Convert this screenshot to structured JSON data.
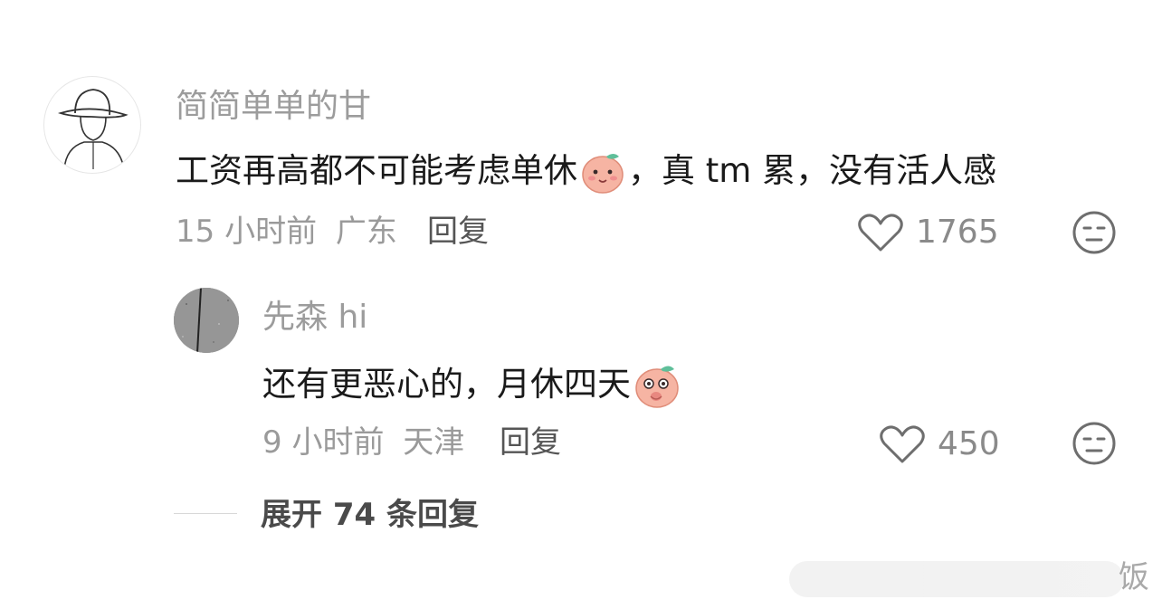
{
  "comment": {
    "username": "简简单单的甘",
    "text_before_emoji": "工资再高都不可能考虑单休",
    "emoji_1": "shy-peach-emoji",
    "text_after_emoji": "，真 tm 累，没有活人感",
    "time_ago": "15 小时前",
    "location": "广东",
    "reply_label": "回复",
    "like_count": "1765"
  },
  "reply": {
    "username": "先森 hi",
    "text_before_emoji": "还有更恶心的，月休四天",
    "emoji_1": "surprised-peach-emoji",
    "time_ago": "9 小时前",
    "location": "天津",
    "reply_label": "回复",
    "like_count": "450"
  },
  "expand": {
    "label": "展开 74 条回复"
  },
  "watermark": {
    "char": "饭"
  },
  "colors": {
    "username": "#9c9c9c",
    "body": "#1a1a1a",
    "meta": "#9a9a9a",
    "peach": "#f2a793"
  }
}
